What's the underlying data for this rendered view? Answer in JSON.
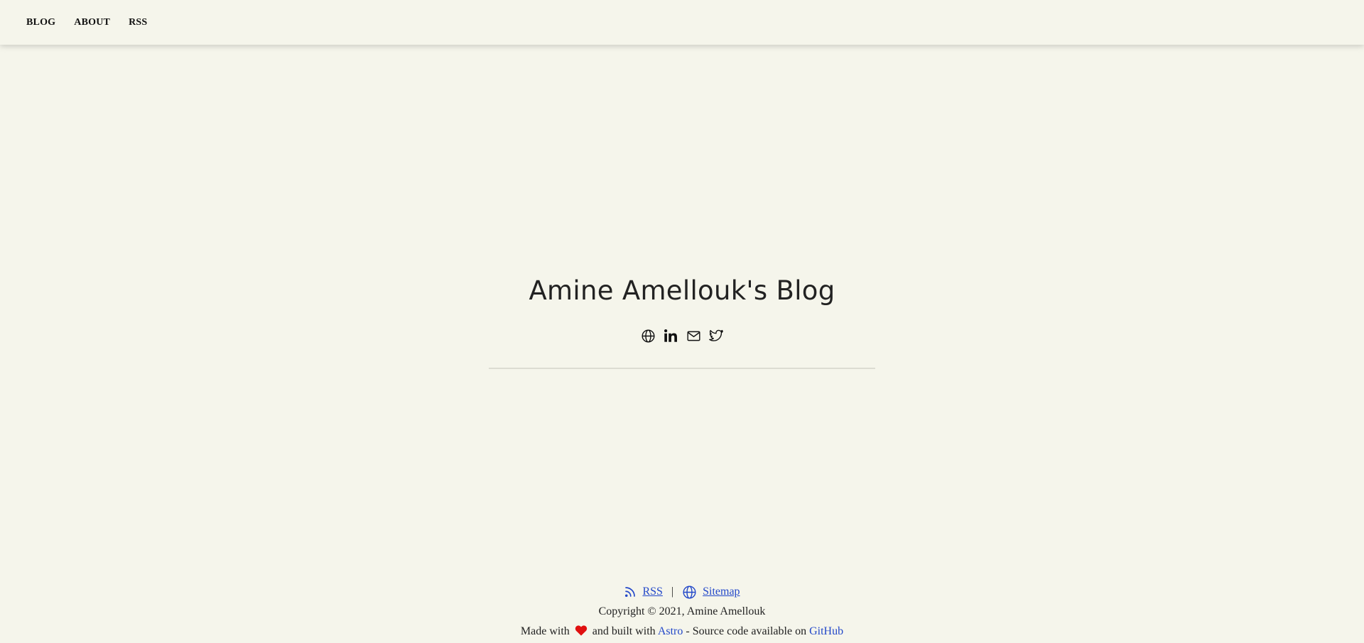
{
  "nav": {
    "items": [
      {
        "label": "BLOG"
      },
      {
        "label": "ABOUT"
      },
      {
        "label": "RSS"
      }
    ]
  },
  "hero": {
    "title": "Amine Amellouk's Blog",
    "social_icons": [
      "globe-icon",
      "linkedin-icon",
      "mail-icon",
      "twitter-icon"
    ]
  },
  "footer": {
    "rss_label": "RSS",
    "separator": "|",
    "sitemap_label": "Sitemap",
    "copyright": "Copyright © 2021, Amine Amellouk",
    "made_with": "Made with",
    "built_with": "and built with",
    "astro_label": "Astro",
    "source_text": "- Source code available on",
    "github_label": "GitHub"
  },
  "colors": {
    "background": "#f5f5eb",
    "link": "#2348c9",
    "heart": "#e01010"
  }
}
